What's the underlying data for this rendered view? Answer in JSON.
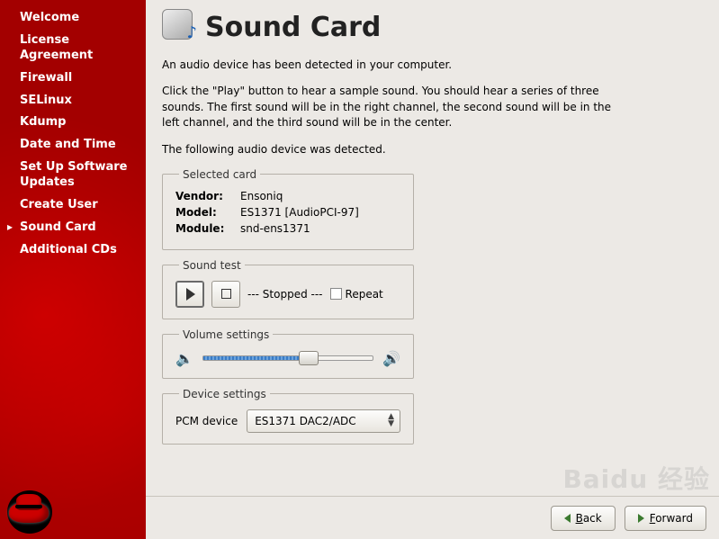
{
  "sidebar": {
    "items": [
      {
        "label": "Welcome"
      },
      {
        "label": "License Agreement"
      },
      {
        "label": "Firewall"
      },
      {
        "label": "SELinux"
      },
      {
        "label": "Kdump"
      },
      {
        "label": "Date and Time"
      },
      {
        "label": "Set Up Software Updates"
      },
      {
        "label": "Create User"
      },
      {
        "label": "Sound Card"
      },
      {
        "label": "Additional CDs"
      }
    ],
    "active_index": 8
  },
  "page": {
    "title": "Sound Card",
    "intro": "An audio device has been detected in your computer.",
    "instructions": "Click the \"Play\" button to hear a sample sound.  You should hear a series of three sounds.  The first sound will be in the right channel, the second sound will be in the left channel, and the third sound will be in the center.",
    "detected": "The following audio device was detected."
  },
  "selected_card": {
    "legend": "Selected card",
    "vendor_label": "Vendor:",
    "vendor": "Ensoniq",
    "model_label": "Model:",
    "model": "ES1371 [AudioPCI-97]",
    "module_label": "Module:",
    "module": "snd-ens1371"
  },
  "sound_test": {
    "legend": "Sound test",
    "status": "--- Stopped ---",
    "repeat_label": "Repeat"
  },
  "volume": {
    "legend": "Volume settings",
    "percent": 62
  },
  "device": {
    "legend": "Device settings",
    "label": "PCM device",
    "selected": "ES1371 DAC2/ADC"
  },
  "buttons": {
    "back": "Back",
    "forward": "Forward"
  },
  "watermark": "Baidu 经验"
}
